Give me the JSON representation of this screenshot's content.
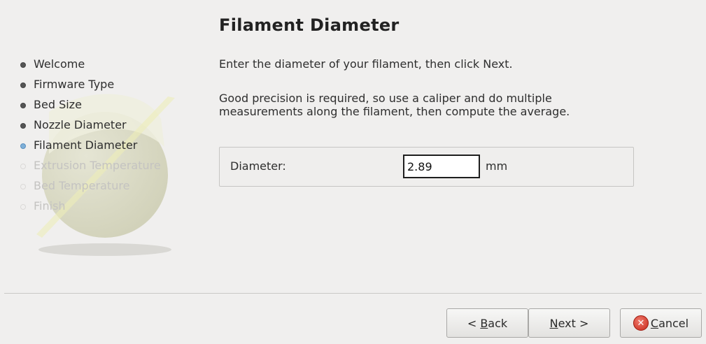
{
  "header": {
    "title": "Filament Diameter"
  },
  "sidebar": {
    "steps": [
      {
        "label": "Welcome",
        "state": "done"
      },
      {
        "label": "Firmware Type",
        "state": "done"
      },
      {
        "label": "Bed Size",
        "state": "done"
      },
      {
        "label": "Nozzle Diameter",
        "state": "done"
      },
      {
        "label": "Filament Diameter",
        "state": "active"
      },
      {
        "label": "Extrusion Temperature",
        "state": "pending"
      },
      {
        "label": "Bed Temperature",
        "state": "pending"
      },
      {
        "label": "Finish",
        "state": "pending"
      }
    ]
  },
  "main": {
    "intro": "Enter the diameter of your filament, then click Next.",
    "precision_line1": "Good precision is required, so use a caliper and do multiple",
    "precision_line2": "measurements along the filament, then compute the average.",
    "diameter_label": "Diameter:",
    "diameter_value": "2.89",
    "unit": "mm"
  },
  "buttons": {
    "back_prefix": "< ",
    "back_mnemonic": "B",
    "back_rest": "ack",
    "next_mnemonic": "N",
    "next_rest": "ext >",
    "cancel_mnemonic": "C",
    "cancel_rest": "ancel"
  },
  "icons": {
    "cancel": "cancel-circle-icon",
    "bullet": "bullet-dot-icon",
    "logo": "slic3r-logo"
  },
  "colors": {
    "active_bullet": "#7fb0d8",
    "cancel_icon": "#c7281a",
    "disabled_text": "#c4c3c1"
  }
}
